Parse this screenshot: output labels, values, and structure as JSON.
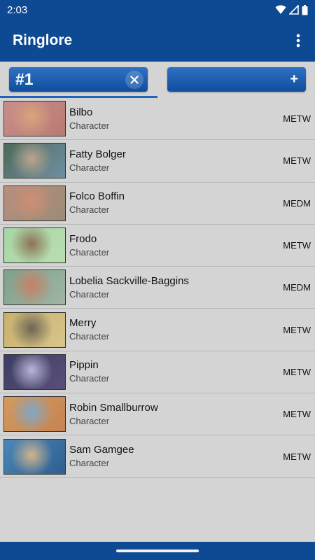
{
  "status": {
    "time": "2:03"
  },
  "app": {
    "title": "Ringlore",
    "overflow_icon": "more-vert-icon"
  },
  "tabs": {
    "active_label": "#1",
    "add_label": "+"
  },
  "colors": {
    "primary": "#0d4a93",
    "tab": "#1e64b8",
    "background": "#d4d4d4"
  },
  "list": [
    {
      "name": "Bilbo",
      "type": "Character",
      "tag": "METW",
      "thumb": [
        "#c98e8a",
        "#d8a47c",
        "#b97a74"
      ]
    },
    {
      "name": "Fatty Bolger",
      "type": "Character",
      "tag": "METW",
      "thumb": [
        "#4e6a5a",
        "#b9a58d",
        "#6e8fa3"
      ]
    },
    {
      "name": "Folco Boffin",
      "type": "Character",
      "tag": "MEDM",
      "thumb": [
        "#b88f7e",
        "#cf8e73",
        "#9b8b76"
      ]
    },
    {
      "name": "Frodo",
      "type": "Character",
      "tag": "METW",
      "thumb": [
        "#a8d6a6",
        "#8c7354",
        "#b8deb0"
      ]
    },
    {
      "name": "Lobelia Sackville-Baggins",
      "type": "Character",
      "tag": "MEDM",
      "thumb": [
        "#7fa08d",
        "#c97f63",
        "#9fb6a3"
      ]
    },
    {
      "name": "Merry",
      "type": "Character",
      "tag": "METW",
      "thumb": [
        "#c9b06c",
        "#6c6554",
        "#d8c58a"
      ]
    },
    {
      "name": "Pippin",
      "type": "Character",
      "tag": "METW",
      "thumb": [
        "#3b3e62",
        "#b7b7d6",
        "#5a4e7a"
      ]
    },
    {
      "name": "Robin Smallburrow",
      "type": "Character",
      "tag": "METW",
      "thumb": [
        "#d49a5e",
        "#7fa7c7",
        "#c58350"
      ]
    },
    {
      "name": "Sam Gamgee",
      "type": "Character",
      "tag": "METW",
      "thumb": [
        "#4b87b8",
        "#cfb48f",
        "#2d5f8e"
      ]
    }
  ]
}
